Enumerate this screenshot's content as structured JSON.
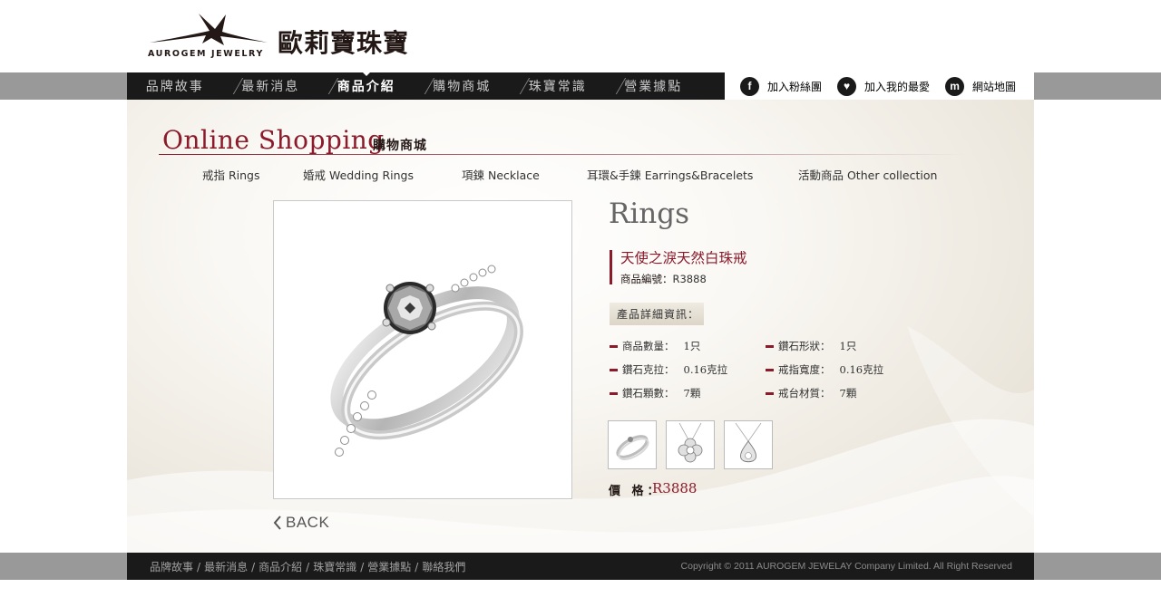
{
  "header": {
    "logo_text": "AUROGEM JEWELRY",
    "logo_cn": "歐莉寶珠寶"
  },
  "nav": {
    "items": [
      {
        "label": "品牌故事"
      },
      {
        "label": "最新消息"
      },
      {
        "label": "商品介紹",
        "active": true
      },
      {
        "label": "購物商城"
      },
      {
        "label": "珠寶常識"
      },
      {
        "label": "營業據點"
      }
    ]
  },
  "utility": [
    {
      "icon": "facebook-icon",
      "glyph": "f",
      "label": "加入粉絲團"
    },
    {
      "icon": "heart-icon",
      "glyph": "♥",
      "label": "加入我的最愛"
    },
    {
      "icon": "sitemap-icon",
      "glyph": "m",
      "label": "網站地圖"
    }
  ],
  "section": {
    "title_en": "Online Shopping",
    "title_cn": "購物商城"
  },
  "categories": [
    {
      "label": "戒指 Rings"
    },
    {
      "label": "婚戒  Wedding Rings"
    },
    {
      "label": "項鍊  Necklace"
    },
    {
      "label": "耳環&手鍊  Earrings&Bracelets"
    },
    {
      "label": "活動商品   Other collection"
    }
  ],
  "product": {
    "category": "Rings",
    "name": "天使之淚天然白珠戒",
    "code_label": "商品編號：",
    "code": "R3888",
    "detail_label": "產品詳細資訊：",
    "specs": [
      {
        "label": "商品數量：",
        "value": "1只"
      },
      {
        "label": "鑽石形狀：",
        "value": "1只"
      },
      {
        "label": "鑽石克拉：",
        "value": "0.16克拉"
      },
      {
        "label": "戒指寬度：",
        "value": "0.16克拉"
      },
      {
        "label": "鑽石顆數：",
        "value": "7顆"
      },
      {
        "label": "戒台材質：",
        "value": "7顆"
      }
    ],
    "price_label": "價 格：",
    "price": "R3888"
  },
  "back_label": "BACK",
  "footer": {
    "links": [
      "品牌故事",
      "最新消息",
      "商品介紹",
      "珠寶常識",
      "營業據點",
      "聯絡我們"
    ],
    "copyright": "Copyright © 2011 AUROGEM JEWELAY Company Limited. All Right Reserved"
  }
}
